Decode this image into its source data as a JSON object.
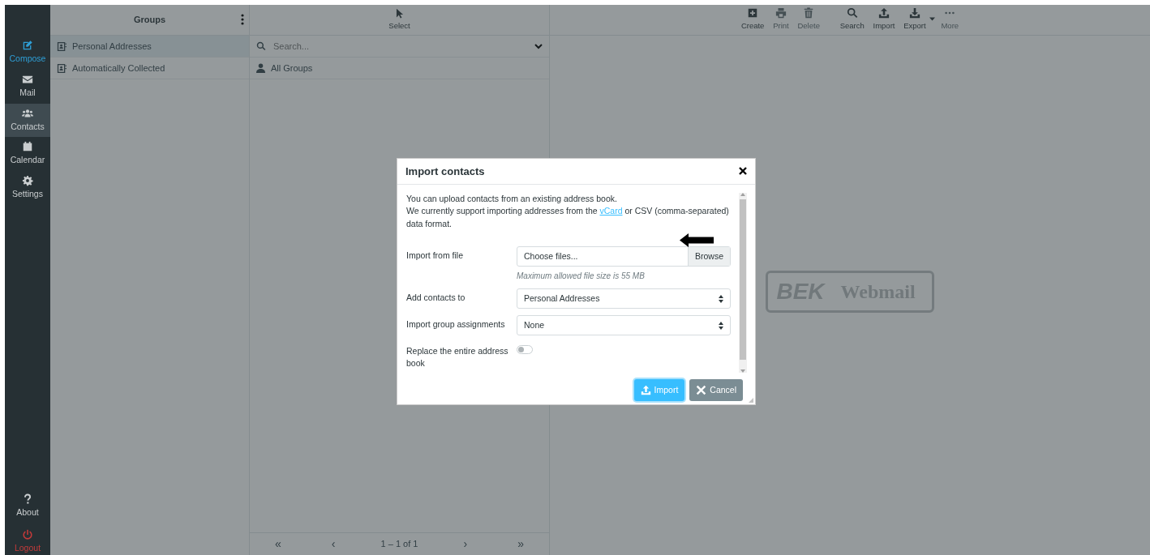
{
  "nav": {
    "items": [
      {
        "label": "Compose",
        "kind": "compose",
        "selected": false,
        "color": "#2f9fd6"
      },
      {
        "label": "Mail",
        "kind": "mail",
        "selected": false,
        "color": "#c9cdcf"
      },
      {
        "label": "Contacts",
        "kind": "contacts",
        "selected": true,
        "color": "#c9cdcf"
      },
      {
        "label": "Calendar",
        "kind": "calendar",
        "selected": false,
        "color": "#c9cdcf"
      },
      {
        "label": "Settings",
        "kind": "settings",
        "selected": false,
        "color": "#c9cdcf"
      }
    ],
    "footer_items": [
      {
        "label": "About",
        "kind": "about",
        "selected": false,
        "color": "#c9cdcf"
      },
      {
        "label": "Logout",
        "kind": "logout",
        "selected": false,
        "color": "#c23a3a"
      }
    ]
  },
  "groups": {
    "title": "Groups",
    "items": [
      {
        "label": "Personal Addresses",
        "selected": true
      },
      {
        "label": "Automatically Collected",
        "selected": false
      }
    ]
  },
  "contacts": {
    "select_label": "Select",
    "search": {
      "placeholder": "Search..."
    },
    "items": [
      {
        "label": "All Groups"
      }
    ],
    "pagination": {
      "first": "«",
      "prev": "‹",
      "info": "1 – 1 of 1",
      "next": "›",
      "last": "»"
    }
  },
  "toolbar": [
    {
      "label": "Create",
      "kind": "create",
      "disabled": false,
      "dropdown": false
    },
    {
      "label": "Print",
      "kind": "print",
      "disabled": true,
      "dropdown": false
    },
    {
      "label": "Delete",
      "kind": "delete",
      "disabled": true,
      "dropdown": false
    },
    {
      "label": "Search",
      "kind": "search",
      "disabled": false,
      "dropdown": false
    },
    {
      "label": "Import",
      "kind": "import",
      "disabled": false,
      "dropdown": false
    },
    {
      "label": "Export",
      "kind": "export",
      "disabled": false,
      "dropdown": true
    },
    {
      "label": "More",
      "kind": "more",
      "disabled": true,
      "dropdown": false
    }
  ],
  "logo": {
    "mark": "BEK",
    "text": "Webmail"
  },
  "dialog": {
    "title": "Import contacts",
    "intro": {
      "line1": "You can upload contacts from an existing address book.",
      "before_link": "We currently support importing addresses from the ",
      "link": "vCard",
      "after_link": " or CSV (comma-separated) data format."
    },
    "fields": [
      {
        "kind": "file",
        "label": "Import from file",
        "placeholder": "Choose files...",
        "button": "Browse",
        "hint": "Maximum allowed file size is 55 MB"
      },
      {
        "kind": "select",
        "label": "Add contacts to",
        "value": "Personal Addresses"
      },
      {
        "kind": "select",
        "label": "Import group assignments",
        "value": "None"
      },
      {
        "kind": "toggle",
        "label": "Replace the entire address book",
        "checked": false
      }
    ],
    "buttons": [
      {
        "label": "Import",
        "kind": "primary"
      },
      {
        "label": "Cancel",
        "kind": "cancel"
      }
    ]
  }
}
